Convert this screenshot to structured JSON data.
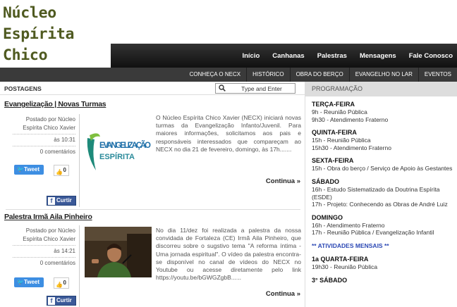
{
  "site": {
    "title": "Núcleo Espírita Chico Xavier"
  },
  "top_nav": [
    "Início",
    "Canhanas",
    "Palestras",
    "Mensagens",
    "Fale Conosco"
  ],
  "sub_nav": [
    "Conheça o NECX",
    "Histórico",
    "Obra do Berço",
    "Evangelho no Lar",
    "Eventos"
  ],
  "postagens": {
    "label": "POSTAGENS",
    "search_placeholder": "Type and Enter"
  },
  "posts": [
    {
      "title": "Evangelização | Novas Turmas",
      "posted_by": "Postado por Núcleo",
      "author": "Espírita Chico Xavier",
      "time": "às 10:31",
      "comments": "0 comentários",
      "tweet": "Tweet",
      "likes": "0",
      "share": "Curtir",
      "image_text_1": "EVANGELIZAÇÃO",
      "image_text_2": "ESPÍRITA",
      "excerpt": "O Núcleo Espírita Chico Xavier (NECX) iniciará novas turmas da Evangelização Infanto/Juvenil. Para maiores informações, solicitamos aos pais e responsáveis interessados que compareçam ao NECX no dia 21 de fevereiro, domingo, às 17h.......",
      "continua": "Continua »"
    },
    {
      "title": "Palestra Irmã Aila Pinheiro",
      "posted_by": "Postado por Núcleo",
      "author": "Espírita Chico Xavier",
      "time": "às 14:21",
      "comments": "0 comentários",
      "tweet": "Tweet",
      "likes": "0",
      "share": "Curtir",
      "excerpt": "No dia 11/dez foi realizada a palestra da nossa convidada de Fortaleza (CE) Irmã Aila Pinheiro, que discorreu sobre o sugstivo tema \"A reforma íntima - Uma jornada espiritual\". O vídeo da palestra encontra-se disponível no canal de vídeos do NECX no Youtube ou acesse diretamente pelo link https://youtu.be/bGWGZgbB......",
      "continua": "Continua »"
    }
  ],
  "sidebar": {
    "header": "PROGRAMAÇÃO",
    "schedule": [
      {
        "day": "TERÇA-FEIRA",
        "entries": [
          "9h - Reunião Pública",
          "9h30 - Atendimento Fraterno"
        ]
      },
      {
        "day": "QUINTA-FEIRA",
        "entries": [
          "15h - Reunião Pública",
          "15h30 - Atendimento Fraterno"
        ]
      },
      {
        "day": "SEXTA-FEIRA",
        "entries": [
          "15h - Obra do berço / Serviço de Apoio às Gestantes"
        ]
      },
      {
        "day": "SÁBADO",
        "entries": [
          "16h - Estudo Sistematizado da Doutrina Espírita (ESDE)",
          "17h - Projeto: Conhecendo as Obras de André Luiz"
        ]
      },
      {
        "day": "DOMINGO",
        "entries": [
          "16h - Atendimento Fraterno",
          "17h - Reunião Pública / Evangelização Infantil"
        ]
      }
    ],
    "mensais": "** ATIVIDADES MENSAIS **",
    "monthly": [
      {
        "day": "1a QUARTA-FEIRA",
        "entries": [
          "19h30 - Reunião Pública"
        ]
      },
      {
        "day": "3° SÁBADO",
        "entries": []
      }
    ]
  },
  "colors": {
    "title": "#4f5a20",
    "nav_bg": "#1a1a1a",
    "tweet": "#3d8ee2",
    "facebook": "#3b5998",
    "mensais": "#2b48b4"
  }
}
